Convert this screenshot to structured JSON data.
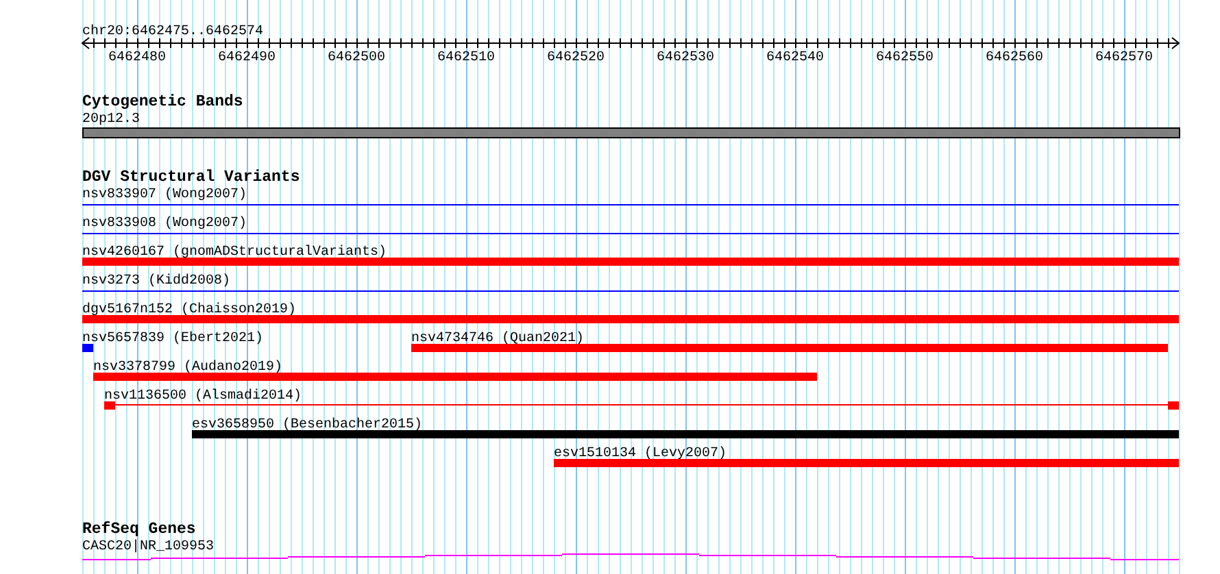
{
  "ruler": {
    "region": "chr20:6462475..6462574",
    "tick_labels": [
      "6462480",
      "6462490",
      "6462500",
      "6462510",
      "6462520",
      "6462530",
      "6462540",
      "6462550",
      "6462560",
      "6462570"
    ]
  },
  "tracks": [
    {
      "kind": "cytoband",
      "title": "Cytogenetic Bands",
      "features": [
        {
          "label": "20p12.3"
        }
      ]
    },
    {
      "kind": "variants",
      "title": "DGV Structural Variants",
      "features": [
        {
          "label": "nsv833907 (Wong2007)",
          "kind": "line",
          "color": "#0000ff"
        },
        {
          "label": "nsv833908 (Wong2007)",
          "kind": "line",
          "color": "#0000ff"
        },
        {
          "label": "nsv4260167 (gnomADStructuralVariants)",
          "kind": "block",
          "color": "#ff0000"
        },
        {
          "label": "nsv3273 (Kidd2008)",
          "kind": "line",
          "color": "#0000ff"
        },
        {
          "label": "dgv5167n152 (Chaisson2019)",
          "kind": "block",
          "color": "#ff0000"
        },
        {
          "label": "nsv5657839 (Ebert2021)",
          "kind": "block",
          "color": "#0000ff"
        },
        {
          "label": "nsv4734746 (Quan2021)",
          "kind": "block",
          "color": "#ff0000"
        },
        {
          "label": "nsv3378799 (Audano2019)",
          "kind": "block",
          "color": "#ff0000"
        },
        {
          "label": "nsv1136500 (Alsmadi2014)",
          "kind": "split",
          "color": "#ff0000"
        },
        {
          "label": "esv3658950 (Besenbacher2015)",
          "kind": "block",
          "color": "#000000"
        },
        {
          "label": "esv1510134 (Levy2007)",
          "kind": "block",
          "color": "#ff0000"
        }
      ]
    },
    {
      "kind": "genes",
      "title": "RefSeq Genes",
      "features": [
        {
          "label": "CASC20|NR_109953"
        }
      ]
    }
  ]
}
